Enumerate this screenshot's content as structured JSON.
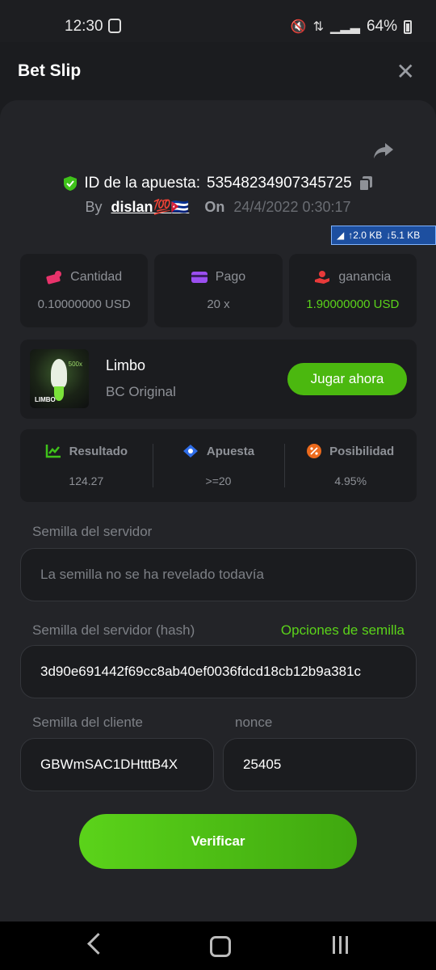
{
  "status_bar": {
    "time": "12:30",
    "battery": "64%"
  },
  "header": {
    "title": "Bet Slip",
    "close_icon": "close-icon"
  },
  "bet": {
    "id_label": "ID de la apuesta:",
    "id_value": "53548234907345725",
    "by_label": "By",
    "username": "dislan💯🇨🇺",
    "on_label": "On",
    "date": "24/4/2022 0:30:17"
  },
  "network_overlay": {
    "up": "↑2.0 KB",
    "down": "↓5.1 KB"
  },
  "summary": {
    "amount": {
      "label": "Cantidad",
      "value": "0.10000000 USD",
      "icon": "money-icon"
    },
    "payout": {
      "label": "Pago",
      "value": "20 x",
      "icon": "card-icon"
    },
    "profit": {
      "label": "ganancia",
      "value": "1.90000000 USD",
      "icon": "profit-hand-icon"
    }
  },
  "game": {
    "thumb_title": "LIMBO",
    "thumb_multiplier": "500x",
    "name": "Limbo",
    "provider": "BC Original",
    "play_label": "Jugar ahora"
  },
  "stats": {
    "result": {
      "label": "Resultado",
      "value": "124.27",
      "icon": "chart-icon"
    },
    "bet": {
      "label": "Apuesta",
      "value": ">=20",
      "icon": "ticket-icon"
    },
    "chance": {
      "label": "Posibilidad",
      "value": "4.95%",
      "icon": "percent-icon"
    }
  },
  "seeds": {
    "server_label": "Semilla del servidor",
    "server_placeholder": "La semilla no se ha revelado todavía",
    "server_hash_label": "Semilla del servidor (hash)",
    "seed_options_label": "Opciones de semilla",
    "server_hash_value": "3d90e691442f69cc8ab40ef0036fdcd18cb12b9a381c",
    "client_label": "Semilla del cliente",
    "client_value": "GBWmSAC1DHtttB4X",
    "nonce_label": "nonce",
    "nonce_value": "25405"
  },
  "verify_label": "Verificar",
  "colors": {
    "accent_green": "#5bd31a",
    "panel_bg": "#232428",
    "card_bg": "#1b1c1f"
  }
}
